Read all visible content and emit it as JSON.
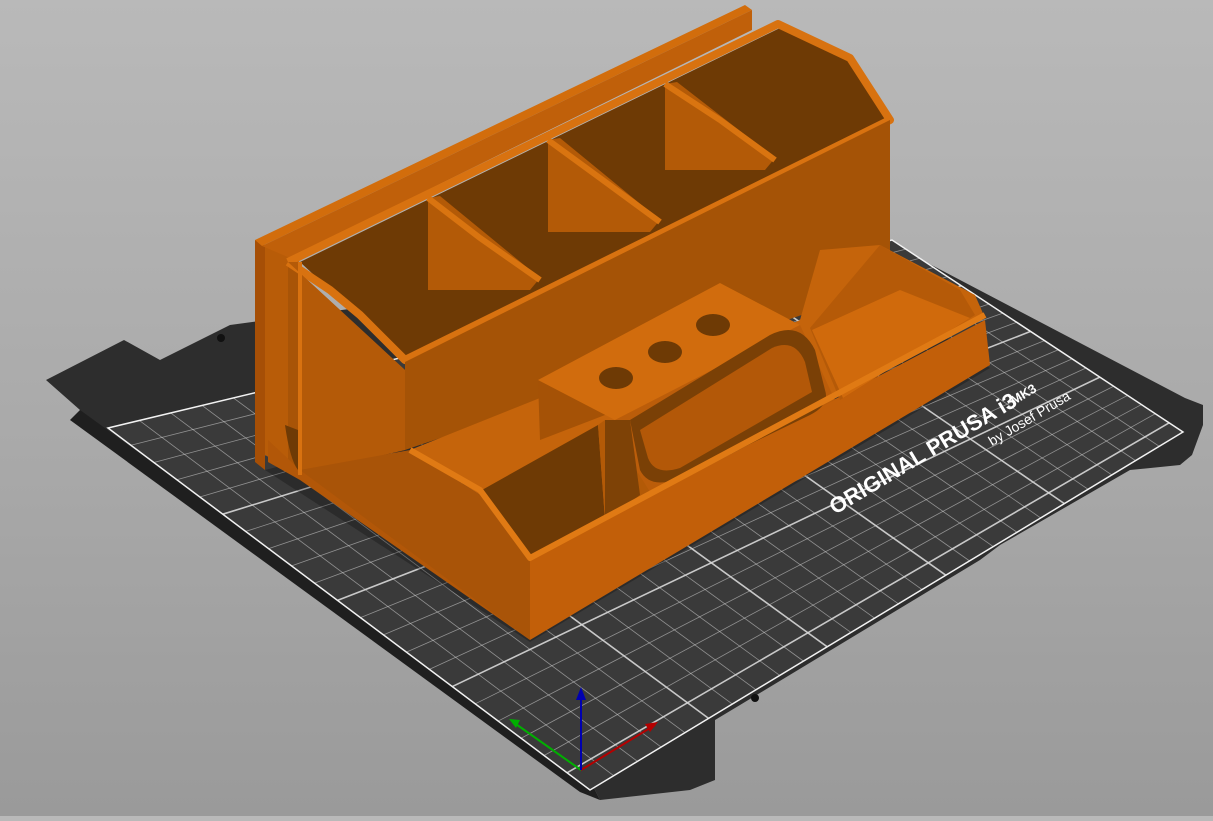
{
  "app": "PrusaSlicer",
  "view": "3D",
  "bed": {
    "printer_name": "ORIGINAL PRUSA i3",
    "model_suffix": "MK3",
    "byline": "by Josef Prusa",
    "plate_color": "#2d2d2d",
    "grid_color": "#f0f0f0"
  },
  "model": {
    "color_top": "#c8650a",
    "color_face": "#a95608",
    "color_inside": "#6b3a06"
  },
  "axes": {
    "x_color": "#b40000",
    "y_color": "#00b000",
    "z_color": "#0000b0"
  }
}
